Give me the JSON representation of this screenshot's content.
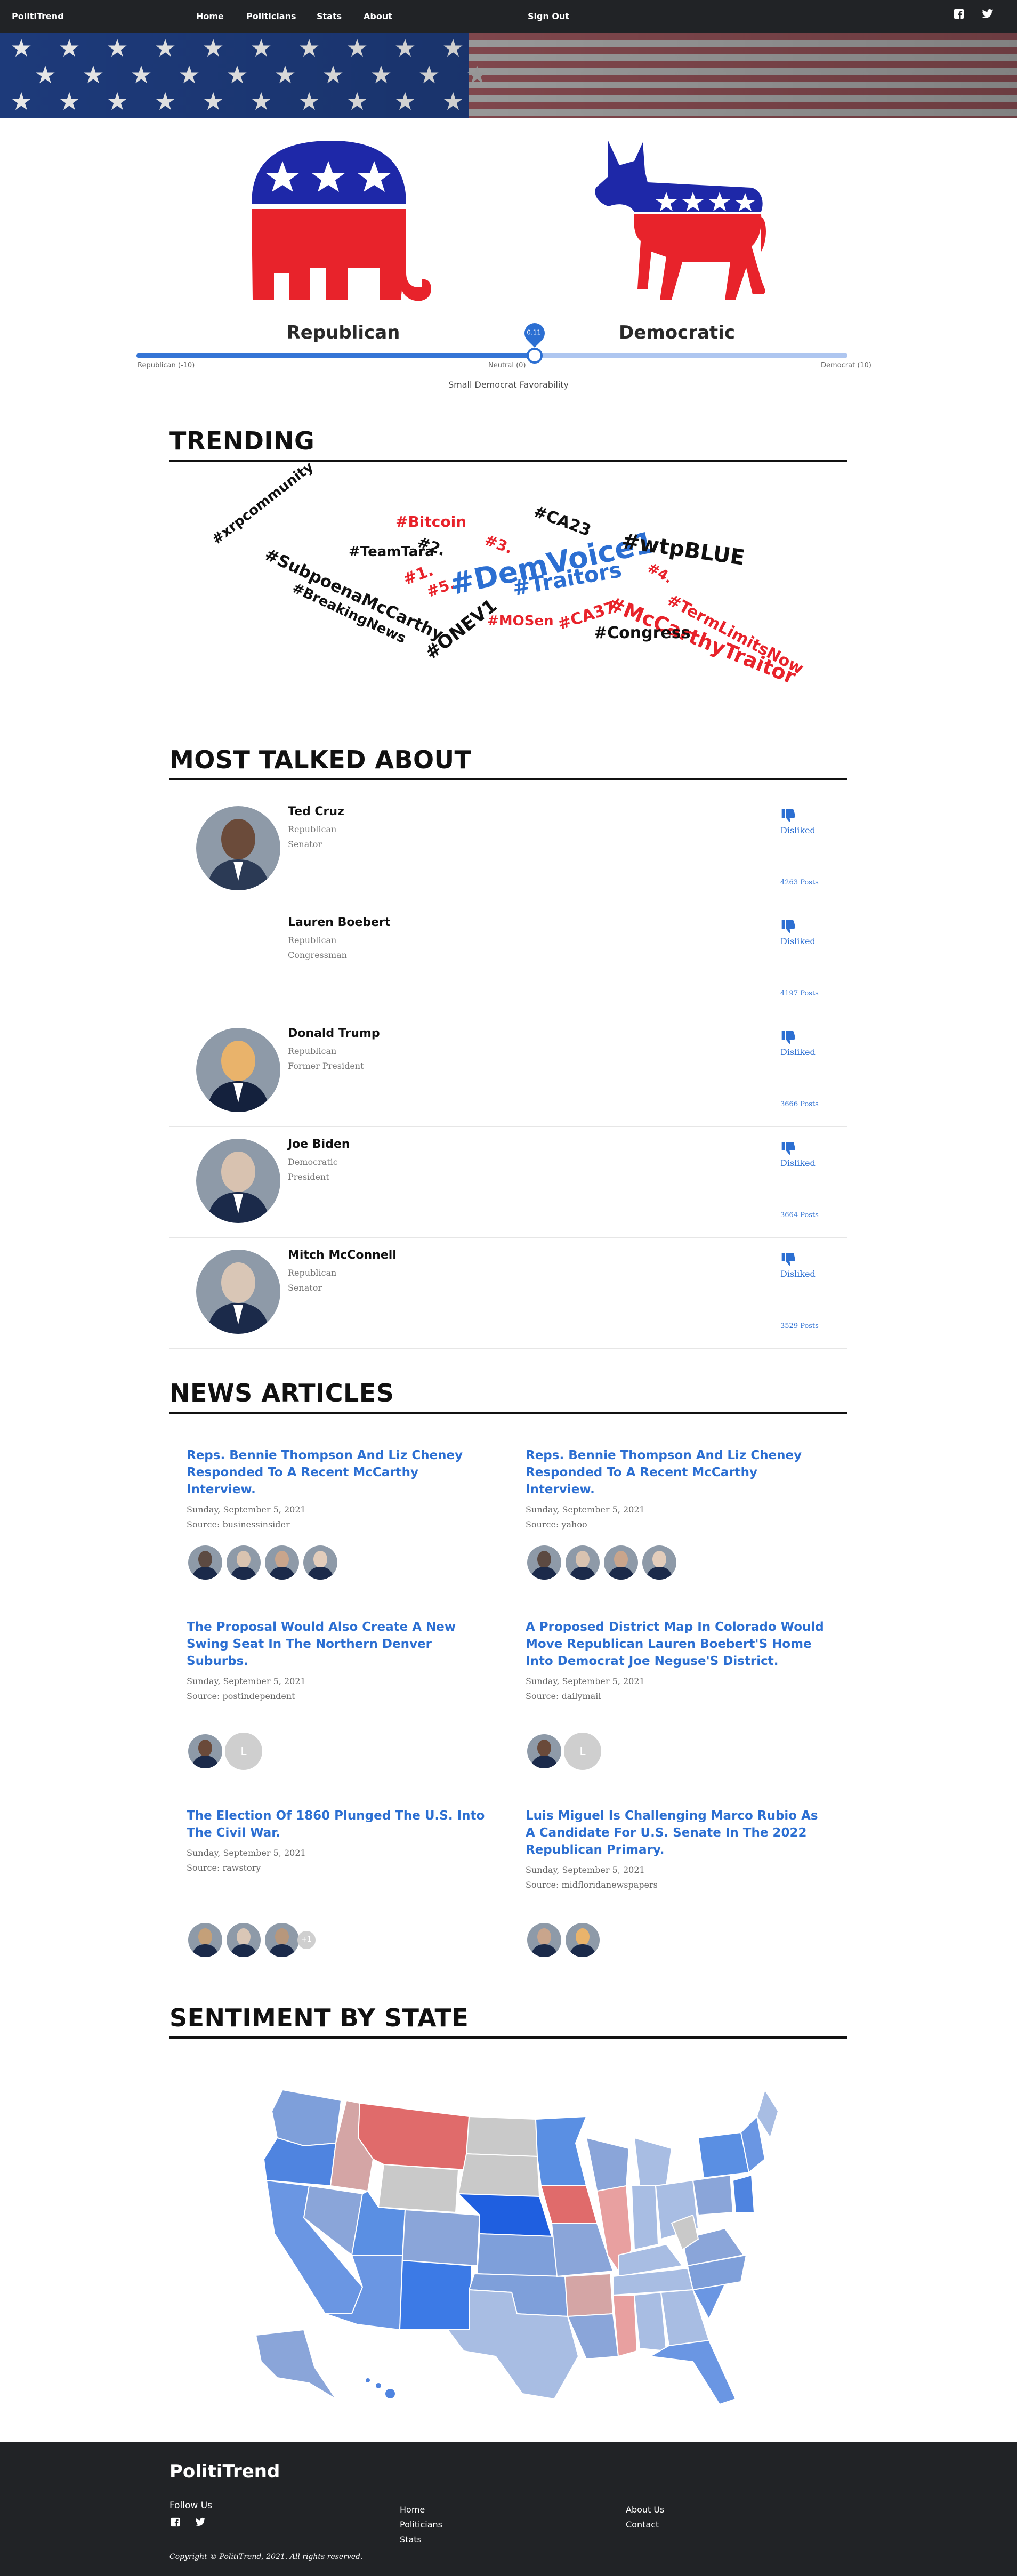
{
  "nav": {
    "brand": "PolitiTrend",
    "links": [
      "Home",
      "Politicians",
      "Stats",
      "About"
    ],
    "signout": "Sign Out",
    "social": [
      "facebook-icon",
      "twitter-icon"
    ]
  },
  "parties": {
    "left": "Republican",
    "right": "Democratic",
    "slider": {
      "value_label": "0.11",
      "position_fraction": 0.56,
      "left_label": "Republican (-10)",
      "mid_label": "Neutral (0)",
      "right_label": "Democrat (10)",
      "caption": "Small Democrat Favorability"
    }
  },
  "colors": {
    "accent": "#2c6fd2",
    "republican": "#e8232b",
    "democrat": "#1b3fc1",
    "dark": "#212326"
  },
  "trending": {
    "title": "TRENDING",
    "words": [
      "#xrpcommunity",
      "#SubpoenaMcCarthy",
      "#BreakingNews",
      "#TeamTara",
      "#2.",
      "#Bitcoin",
      "#1.",
      "#5.",
      "#3.",
      "#ONEV1",
      "#DemVoice1",
      "#Traitors",
      "#CA23",
      "#wtpBLUE",
      "#4.",
      "#MOSen",
      "#CA37",
      "#McCarthyTraitor",
      "#TermLimitsNow",
      "#Congress"
    ]
  },
  "most_talked": {
    "title": "MOST TALKED ABOUT",
    "people": [
      {
        "name": "Ted Cruz",
        "party": "Republican",
        "role": "Senator",
        "sentiment": "Disliked",
        "posts": "4263 Posts"
      },
      {
        "name": "Lauren Boebert",
        "party": "Republican",
        "role": "Congressman",
        "sentiment": "Disliked",
        "posts": "4197 Posts"
      },
      {
        "name": "Donald Trump",
        "party": "Republican",
        "role": "Former President",
        "sentiment": "Disliked",
        "posts": "3666 Posts"
      },
      {
        "name": "Joe Biden",
        "party": "Democratic",
        "role": "President",
        "sentiment": "Disliked",
        "posts": "3664 Posts"
      },
      {
        "name": "Mitch McConnell",
        "party": "Republican",
        "role": "Senator",
        "sentiment": "Disliked",
        "posts": "3529 Posts"
      }
    ]
  },
  "news": {
    "title": "NEWS ARTICLES",
    "articles": [
      {
        "title": "Reps. Bennie Thompson And Liz Cheney Responded To A Recent McCarthy Interview.",
        "date": "Sunday, September 5, 2021",
        "source": "Source: businessinsider"
      },
      {
        "title": "Reps. Bennie Thompson And Liz Cheney Responded To A Recent McCarthy Interview.",
        "date": "Sunday, September 5, 2021",
        "source": "Source: yahoo"
      },
      {
        "title": "The Proposal Would Also Create A New Swing Seat In The Northern Denver Suburbs.",
        "date": "Sunday, September 5, 2021",
        "source": "Source: postindependent"
      },
      {
        "title": "A Proposed District Map In Colorado Would Move Republican Lauren Boebert'S Home Into Democrat Joe Neguse'S District.",
        "date": "Sunday, September 5, 2021",
        "source": "Source: dailymail"
      },
      {
        "title": "The Election Of 1860 Plunged The U.S. Into The Civil War.",
        "date": "Sunday, September 5, 2021",
        "source": "Source: rawstory"
      },
      {
        "title": "Luis Miguel Is Challenging Marco Rubio As A Candidate For U.S. Senate In The 2022 Republican Primary.",
        "date": "Sunday, September 5, 2021",
        "source": "Source: midfloridanewspapers"
      }
    ],
    "avatar_letter": "L",
    "more_badge": "+1"
  },
  "sentiment": {
    "title": "SENTIMENT BY STATE"
  },
  "footer": {
    "brand": "PolitiTrend",
    "follow": "Follow Us",
    "col2": [
      "Home",
      "Politicians",
      "Stats"
    ],
    "col3": [
      "About Us",
      "Contact"
    ],
    "copyright": "Copyright © PolitiTrend, 2021. All rights reserved."
  }
}
